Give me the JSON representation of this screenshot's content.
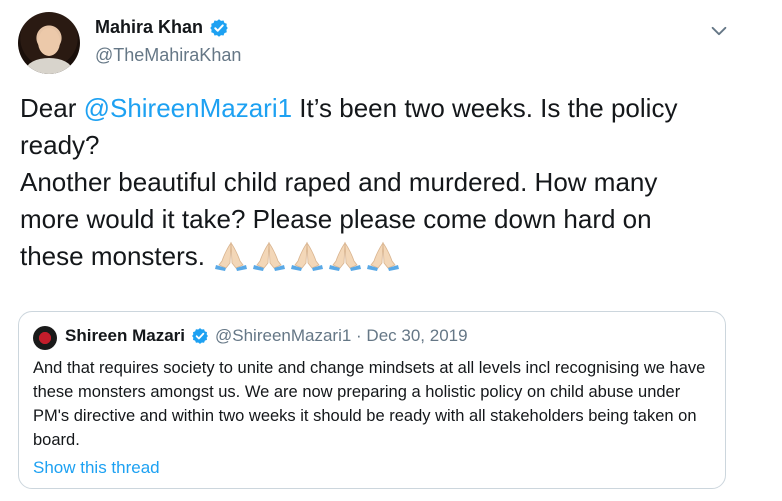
{
  "tweet": {
    "author_name": "Mahira Khan",
    "author_handle": "@TheMahiraKhan",
    "text_prefix": "Dear ",
    "mention": "@ShireenMazari1",
    "text_body": " It’s been two weeks. Is the policy ready?\nAnother beautiful child raped and murdered. How many more would it take? Please please come down hard on these monsters.",
    "emoji_count": 5,
    "emoji_name": "folded-hands-emoji"
  },
  "quote": {
    "author_name": "Shireen Mazari",
    "meta": "@ShireenMazari1 · Dec 30, 2019",
    "text": "And that requires society to unite and change mindsets at all levels incl recognising we have these monsters amongst us. We are now preparing a holistic policy on child abuse under PM's directive and within two weeks it should be ready with all stakeholders being taken on board.",
    "link": "Show this thread"
  },
  "colors": {
    "accent": "#1da1f2",
    "secondary_text": "#657786",
    "border": "#ccd6dd"
  }
}
